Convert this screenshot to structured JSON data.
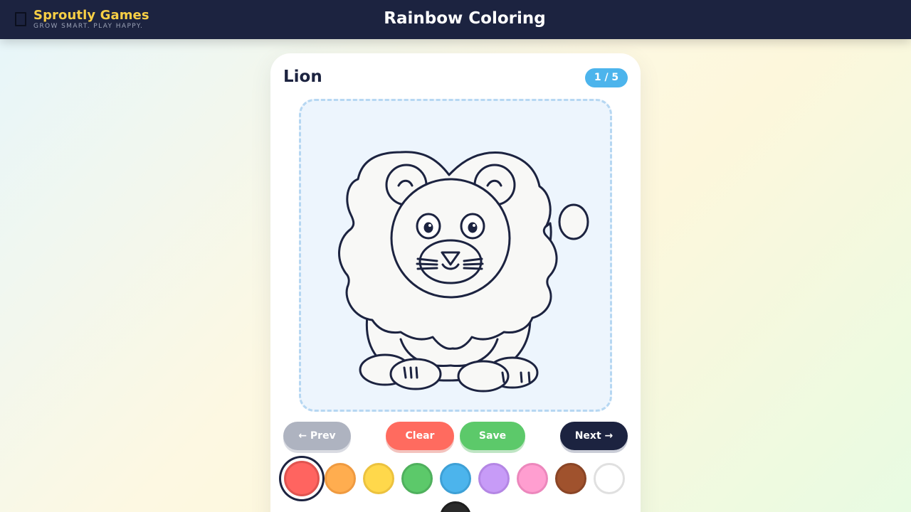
{
  "header": {
    "brand_name": "Sproutly Games",
    "brand_tagline": "GROW SMART. PLAY HAPPY.",
    "title": "Rainbow Coloring"
  },
  "page": {
    "item_title": "Lion",
    "counter": "1 / 5"
  },
  "controls": {
    "prev_label": "← Prev",
    "clear_label": "Clear",
    "save_label": "Save",
    "next_label": "Next →"
  },
  "palette": {
    "selected": "red",
    "colors": [
      {
        "name": "red",
        "hex": "#ff6460",
        "border": "#e05450"
      },
      {
        "name": "orange",
        "hex": "#ffad4f",
        "border": "#ef9a40"
      },
      {
        "name": "yellow",
        "hex": "#ffd84b",
        "border": "#ecc23e"
      },
      {
        "name": "green",
        "hex": "#5cc96a",
        "border": "#4fb05d"
      },
      {
        "name": "blue",
        "hex": "#4cb4ec",
        "border": "#3ea0d6"
      },
      {
        "name": "purple",
        "hex": "#c79bf7",
        "border": "#b486e4"
      },
      {
        "name": "pink",
        "hex": "#ff9ed0",
        "border": "#ec87bc"
      },
      {
        "name": "brown",
        "hex": "#a0522d",
        "border": "#8a4526"
      },
      {
        "name": "white",
        "hex": "#ffffff",
        "border": "#e0e0e0"
      },
      {
        "name": "black",
        "hex": "#2a2a2a",
        "border": "#1e1e1e"
      }
    ]
  }
}
